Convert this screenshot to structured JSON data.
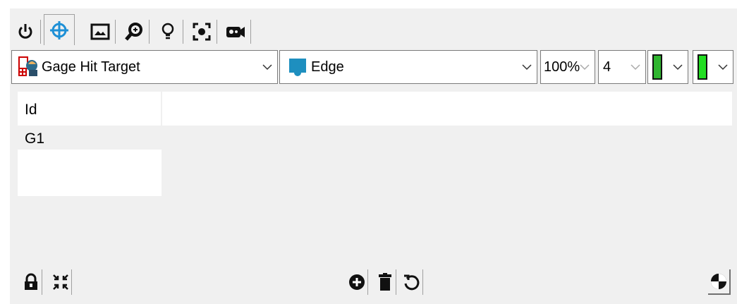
{
  "tabs": [
    {
      "icon": "power-icon"
    },
    {
      "icon": "crosshair-target-icon",
      "active": true
    },
    {
      "icon": "image-icon"
    },
    {
      "icon": "zoom-icon"
    },
    {
      "icon": "lightbulb-icon"
    },
    {
      "icon": "focus-frame-icon"
    },
    {
      "icon": "camera-icon"
    }
  ],
  "toolbar": {
    "tool_select": {
      "value": "Gage Hit Target",
      "icon": "gage-hit-target-icon"
    },
    "mode_select": {
      "value": "Edge",
      "icon": "edge-icon"
    },
    "zoom_select": {
      "value": "100%"
    },
    "width_select": {
      "value": "4"
    },
    "color1_select": {
      "value": "",
      "color": "#2fb52f"
    },
    "color2_select": {
      "value": "",
      "color": "#22dd22"
    }
  },
  "table": {
    "header": "Id",
    "rows": [
      "G1"
    ]
  },
  "bottom_bar": {
    "left": [
      "lock-icon",
      "collapse-icon"
    ],
    "center": [
      "add-icon",
      "delete-icon",
      "reset-icon"
    ],
    "right": [
      "color-wheel-icon"
    ]
  },
  "colors": {
    "accent": "#1e90d6",
    "panel": "#f0f0f0"
  }
}
